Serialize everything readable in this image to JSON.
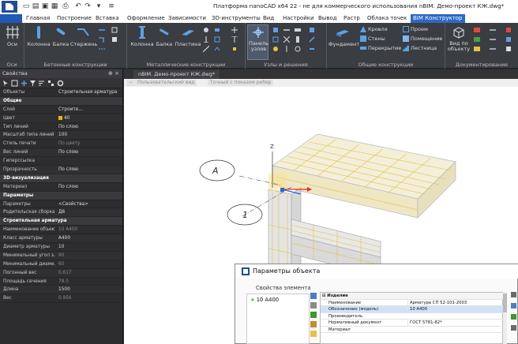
{
  "app": {
    "title": "Платформа nanoCAD x64 22 - не для коммерческого использования nBIM. Демо-проект КЖ.dwg*"
  },
  "ribbon": {
    "tabs": [
      "Главная",
      "Построение",
      "Вставка",
      "Оформление",
      "Зависимости",
      "3D-инструменты",
      "Вид",
      "Настройки",
      "Вывод",
      "Растр",
      "Облака точек",
      "BIM Конструктор"
    ],
    "active_tab": "BIM Конструктор",
    "groups": [
      {
        "label": "Оси",
        "buttons": [
          "Оси"
        ]
      },
      {
        "label": "Бетонные конструкции",
        "buttons": [
          "Колонна",
          "Балка",
          "Стержень"
        ]
      },
      {
        "label": "Металлические конструкции",
        "buttons": [
          "Колонна",
          "Балка",
          "Пластина"
        ]
      },
      {
        "label": "Узлы и решения",
        "buttons": [
          "Панель узлов"
        ]
      },
      {
        "label": "Общие конструкции",
        "buttons": [
          "Фундамент",
          "Кровля",
          "Стены",
          "Перекрытие",
          "Проем",
          "Помещение",
          "Лестница"
        ]
      },
      {
        "label": "Документирование",
        "buttons": [
          "Вид по объекту"
        ]
      }
    ]
  },
  "properties": {
    "title": "Свойства",
    "controls": "⊕ ×",
    "rows": [
      {
        "type": "row",
        "k": "Объекты",
        "v": "Строительная арматура"
      },
      {
        "type": "section",
        "k": "Общие"
      },
      {
        "type": "row",
        "k": "Слой",
        "v": "Строите..."
      },
      {
        "type": "row",
        "k": "Цвет",
        "v": "40",
        "swatch": true
      },
      {
        "type": "row",
        "k": "Тип линий",
        "v": "По слою"
      },
      {
        "type": "row",
        "k": "Масштаб типа линий",
        "v": "100"
      },
      {
        "type": "row",
        "k": "Стиль печати",
        "v": "По цвету",
        "dim": true
      },
      {
        "type": "row",
        "k": "Вес линий",
        "v": "По слою"
      },
      {
        "type": "row",
        "k": "Гиперссылка",
        "v": ""
      },
      {
        "type": "row",
        "k": "Прозрачность",
        "v": "По слою"
      },
      {
        "type": "section",
        "k": "3D-визуализация"
      },
      {
        "type": "row",
        "k": "Материал",
        "v": "По слою"
      },
      {
        "type": "section",
        "k": "Параметры"
      },
      {
        "type": "row",
        "k": "Параметры",
        "v": "<Свойства>"
      },
      {
        "type": "row",
        "k": "Родительская сборка",
        "v": "Д6"
      },
      {
        "type": "section",
        "k": "Строительная арматура"
      },
      {
        "type": "row",
        "k": "Наименование объекта",
        "v": "10 A400",
        "dim": true
      },
      {
        "type": "row",
        "k": "Класс арматуры",
        "v": "A400"
      },
      {
        "type": "row",
        "k": "Диаметр арматуры",
        "v": "10"
      },
      {
        "type": "row",
        "k": "Минимальный угол з...",
        "v": "90",
        "dim": true
      },
      {
        "type": "row",
        "k": "Минимальный диаме...",
        "v": "60",
        "dim": true
      },
      {
        "type": "row",
        "k": "Погонный вес",
        "v": "0.617",
        "dim": true
      },
      {
        "type": "row",
        "k": "Площадь сечения",
        "v": "78.5",
        "dim": true
      },
      {
        "type": "row",
        "k": "Длина",
        "v": "1500"
      },
      {
        "type": "row",
        "k": "Вес",
        "v": "0.956",
        "dim": true
      }
    ]
  },
  "document": {
    "tab": "nBIM. Демо-проект КЖ.dwg*",
    "view_buttons": [
      "−",
      "Пользовательский вид",
      "Точный с показом ребер"
    ],
    "axis_labels": [
      "А",
      "1"
    ],
    "z_label": "Z"
  },
  "dialog": {
    "title": "Параметры объекта",
    "subtitle": "Свойства элемента",
    "tree_item": "10 A400",
    "section": "Изделие",
    "grid": [
      {
        "k": "Наименование",
        "v": "Арматура СП 52-101-2003"
      },
      {
        "k": "Обозначение (модель)",
        "v": "10 A400",
        "sel": true
      },
      {
        "k": "Производитель",
        "v": ""
      },
      {
        "k": "Нормативный документ",
        "v": "ГОСТ 5781-82*"
      },
      {
        "k": "Материал",
        "v": ""
      }
    ]
  },
  "colors": {
    "accent": "#2d68c7",
    "panel": "#2d2d30",
    "ribbon": "#3a3d42",
    "rebar_yellow": "#e8c23a",
    "highlight": "#cfe2f7"
  }
}
